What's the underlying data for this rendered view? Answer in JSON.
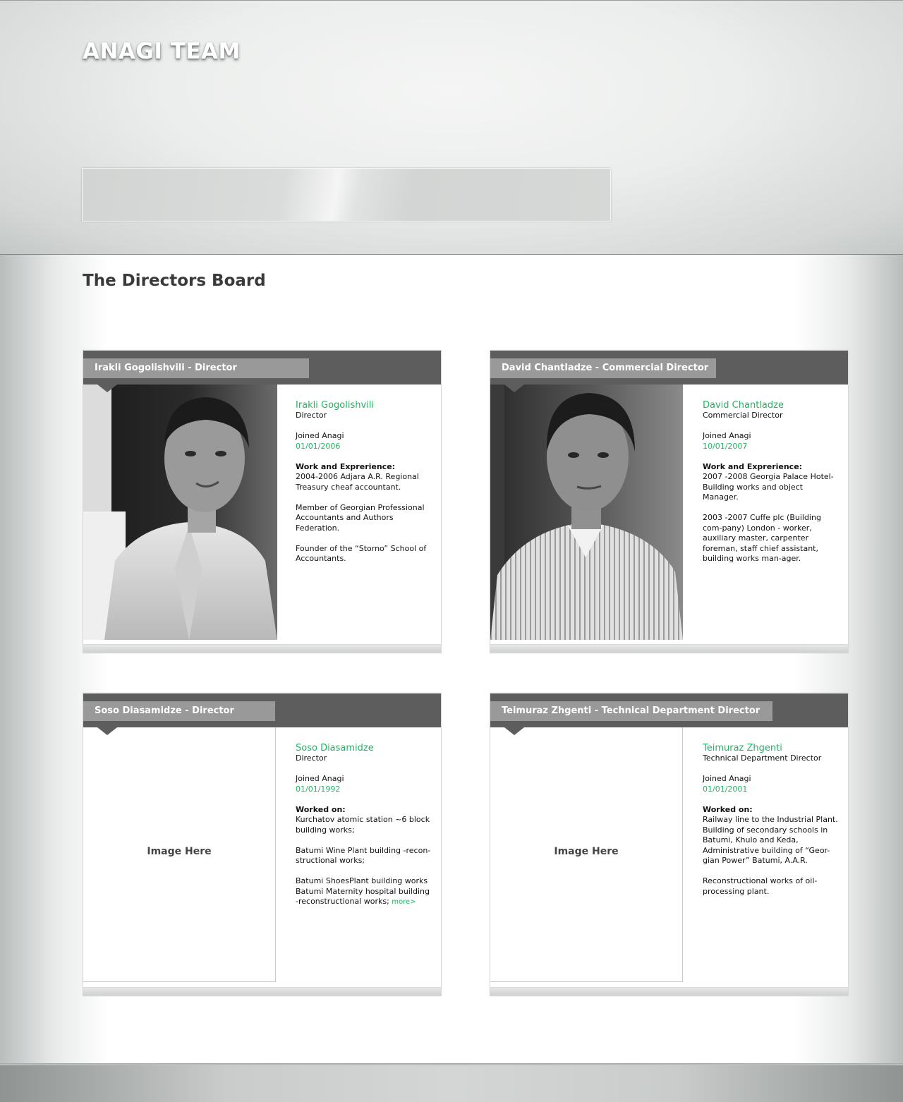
{
  "site": {
    "title": "ANAGI TEAM"
  },
  "section": {
    "title": "The Directors Board"
  },
  "cards": [
    {
      "tab": "Irakli Gogolishvili - Director",
      "name": "Irakli Gogolishvili",
      "role": "Director",
      "joined_label": "Joined Anagi",
      "joined_date": "01/01/2006",
      "section_label": "Work and Exprerience:",
      "paragraphs": [
        "2004-2006 Adjara A.R. Regional Treasury cheaf accountant.",
        "Member of Georgian Professional Accountants and Authors Federation.",
        "Founder of the “Storno” School of Accountants."
      ],
      "photo": "portrait-photo"
    },
    {
      "tab": "David Chantladze - Commercial Director",
      "name": "David Chantladze",
      "role": "Commercial Director",
      "joined_label": "Joined Anagi",
      "joined_date": "10/01/2007",
      "section_label": "Work and Exprerience:",
      "paragraphs": [
        "2007 -2008 Georgia Palace Hotel-Building works and object Manager.",
        "2003 -2007 Cuffe plc (Building com-pany) London - worker, auxiliary master, carpenter foreman, staff chief assistant, building works man-ager."
      ],
      "photo": "portrait-photo"
    },
    {
      "tab": "Soso Diasamidze - Director",
      "name": "Soso Diasamidze",
      "role": "Director",
      "joined_label": "Joined Anagi",
      "joined_date": "01/01/1992",
      "section_label": "Worked on:",
      "paragraphs": [
        "Kurchatov atomic station ~6 block building works;",
        "Batumi Wine Plant building -recon-structional works;",
        "Batumi ShoesPlant building works Batumi Maternity hospital building -reconstructional works;"
      ],
      "more": "more>",
      "placeholder": "Image Here"
    },
    {
      "tab": "Teimuraz Zhgenti - Technical Department Director",
      "name": "Teimuraz Zhgenti",
      "role": "Technical Department Director",
      "joined_label": "Joined Anagi",
      "joined_date": "01/01/2001",
      "section_label": "Worked on:",
      "paragraphs": [
        "Railway line to the Industrial Plant. Building of secondary schools in Batumi, Khulo and Keda, Administrative building of “Geor-gian Power” Batumi, A.A.R.",
        "Reconstructional works of oil-processing plant."
      ],
      "placeholder": "Image Here"
    }
  ]
}
